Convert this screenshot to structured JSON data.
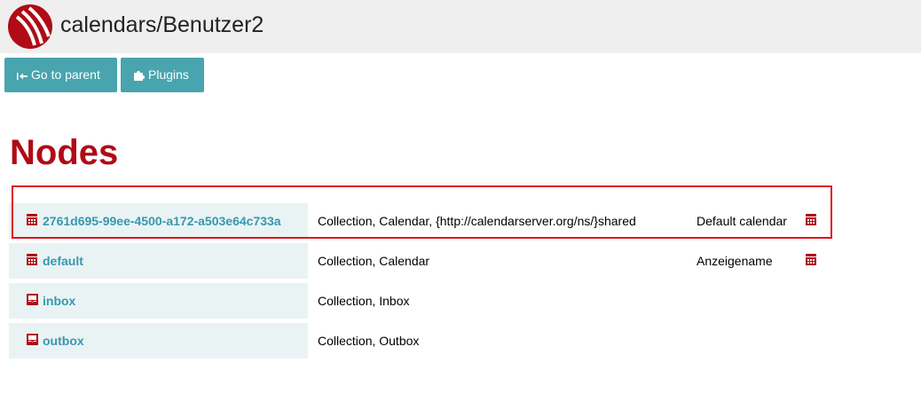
{
  "header": {
    "title": "calendars/Benutzer2"
  },
  "toolbar": {
    "parent_label": "Go to parent",
    "plugins_label": "Plugins"
  },
  "section": {
    "heading": "Nodes"
  },
  "nodes": [
    {
      "name": "2761d695-99ee-4500-a172-a503e64c733a",
      "types": "Collection, Calendar, {http://calendarserver.org/ns/}shared",
      "display": "Default calendar",
      "icon": "calendar-icon",
      "action_icon": "calendar-icon",
      "highlighted": true
    },
    {
      "name": "default",
      "types": "Collection, Calendar",
      "display": "Anzeigename",
      "icon": "calendar-icon",
      "action_icon": "calendar-icon"
    },
    {
      "name": "inbox",
      "types": "Collection, Inbox",
      "icon": "inbox-icon"
    },
    {
      "name": "outbox",
      "types": "Collection, Outbox",
      "icon": "inbox-icon"
    }
  ],
  "colors": {
    "accent": "#b00b16",
    "button": "#48a4ae",
    "link": "#3598b0",
    "row_bg": "#eaf3f4",
    "highlight": "#e0141b"
  }
}
